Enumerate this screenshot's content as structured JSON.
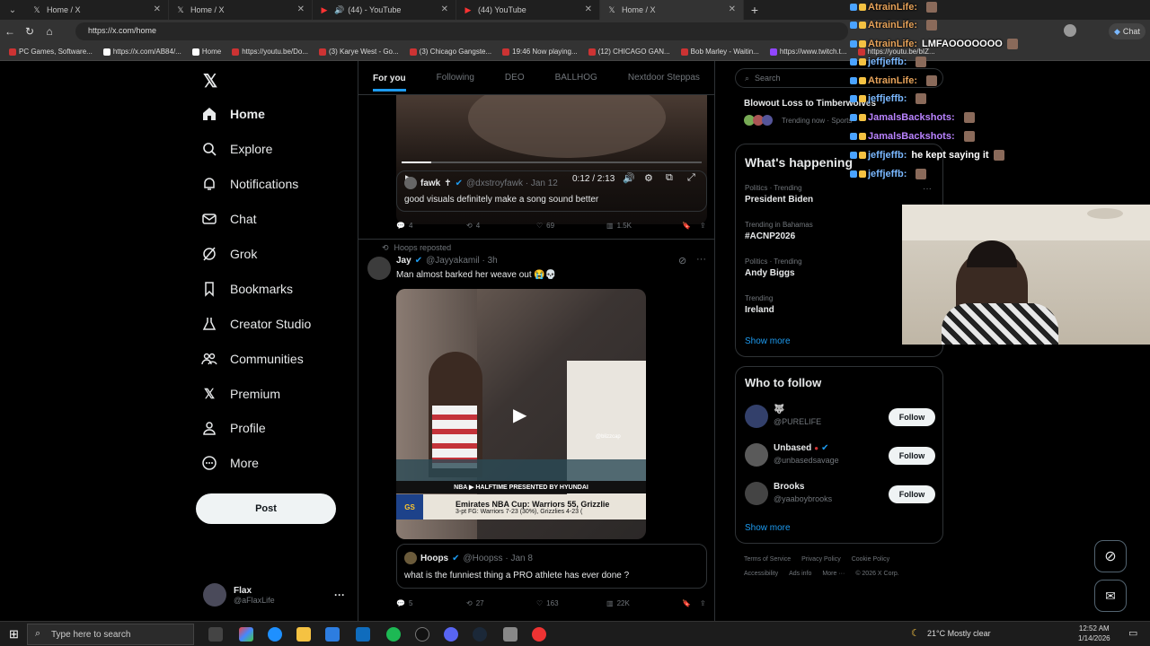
{
  "browser": {
    "tabs": [
      {
        "title": "Home / X",
        "icon": "x-logo-icon"
      },
      {
        "title": "Home / X",
        "icon": "x-logo-icon"
      },
      {
        "title": "(44) - YouTube",
        "icon": "youtube-icon"
      },
      {
        "title": "(44) YouTube",
        "icon": "youtube-icon"
      },
      {
        "title": "Home / X",
        "icon": "x-logo-icon"
      }
    ],
    "url": "https://x.com/home",
    "chat_label": "Chat",
    "bookmarks": [
      "PC Games, Software...",
      "https://x.com/AB84/...",
      "Home",
      "https://youtu.be/Do...",
      "(3) Karye West - Go...",
      "(3) Chicago Gangste...",
      "19:46 Now playing...",
      "(12) CHICAGO GAN...",
      "Bob Marley - Waitin...",
      "https://www.twitch.t...",
      "https://youtu.be/bIZ..."
    ]
  },
  "nav": {
    "items": [
      "Home",
      "Explore",
      "Notifications",
      "Chat",
      "Grok",
      "Bookmarks",
      "Creator Studio",
      "Communities",
      "Premium",
      "Profile",
      "More"
    ],
    "post_label": "Post",
    "profile_name": "Flax",
    "profile_handle": "@aFlaxLife",
    "more_dots": "···"
  },
  "timeline": {
    "tabs": [
      "For you",
      "Following",
      "DEO",
      "BALLHOG",
      "Nextdoor Steppas"
    ],
    "tweet1": {
      "video_time": "0:12 / 2:13",
      "quote_name": "fawk",
      "quote_name_suffix": "✝",
      "quote_handle_date": "@dxstroyfawk · Jan 12",
      "quote_text": "good visuals definitely make a song sound better",
      "replies": "4",
      "reposts": "4",
      "likes": "69",
      "views": "1.5K"
    },
    "tweet2": {
      "repost_label": "Hoops reposted",
      "name": "Jay",
      "handle_time": "@Jayyakamil · 3h",
      "text": "Man almost barked her weave out 😭💀",
      "video_watermark": "@blizzcap",
      "banner_top": "NBA ▶ HALFTIME PRESENTED BY HYUNDAI",
      "banner_team": "GS",
      "banner_main": "Emirates NBA Cup: Warriors 55, Grizzlie",
      "banner_sub": "3-pt FG: Warriors 7-23 (30%), Grizzlies 4-23 (",
      "quote_name": "Hoops",
      "quote_handle_date": "@Hoopss · Jan 8",
      "quote_text": "what is the funniest thing a PRO athlete has ever done ?",
      "replies": "5",
      "reposts": "27",
      "likes": "163",
      "views": "22K"
    }
  },
  "sidebar": {
    "search_placeholder": "Search",
    "top_trend_title": "Blowout Loss to Timberwolves",
    "top_trend_meta": "Trending now · Sports",
    "whats_happening": "What's happening",
    "trends": [
      {
        "meta": "Politics · Trending",
        "title": "President Biden"
      },
      {
        "meta": "Trending in Bahamas",
        "title": "#ACNP2026"
      },
      {
        "meta": "Politics · Trending",
        "title": "Andy Biggs"
      },
      {
        "meta": "Trending",
        "title": "Ireland"
      }
    ],
    "show_more": "Show more",
    "who_to_follow": "Who to follow",
    "follow_suggestions": [
      {
        "name": "",
        "handle": "@PURELIFE"
      },
      {
        "name": "Unbased",
        "handle": "@unbasedsavage"
      },
      {
        "name": "Brooks",
        "handle": "@yaaboybrooks"
      }
    ],
    "follow_label": "Follow",
    "footer_line1": [
      "Terms of Service",
      "Privacy Policy",
      "Cookie Policy"
    ],
    "footer_line2": [
      "Accessibility",
      "Ads info",
      "More ···",
      "© 2026 X Corp."
    ]
  },
  "chat_overlay": [
    {
      "user": "AtrainLife:",
      "msg": "",
      "color": "#e7a35a"
    },
    {
      "user": "AtrainLife:",
      "msg": "",
      "color": "#e7a35a"
    },
    {
      "user": "AtrainLife:",
      "msg": "LMFAOOOOOOO",
      "color": "#e7a35a"
    },
    {
      "user": "jeffjeffb:",
      "msg": "",
      "color": "#7ab8ff"
    },
    {
      "user": "AtrainLife:",
      "msg": "",
      "color": "#e7a35a"
    },
    {
      "user": "jeffjeffb:",
      "msg": "",
      "color": "#7ab8ff"
    },
    {
      "user": "JamalsBackshots:",
      "msg": "",
      "color": "#b983ff"
    },
    {
      "user": "JamalsBackshots:",
      "msg": "",
      "color": "#b983ff"
    },
    {
      "user": "jeffjeffb:",
      "msg": "he kept saying it",
      "color": "#7ab8ff"
    },
    {
      "user": "jeffjeffb:",
      "msg": "",
      "color": "#7ab8ff"
    }
  ],
  "taskbar": {
    "search_placeholder": "Type here to search",
    "weather": "21°C  Mostly clear",
    "time": "12:52 AM",
    "date": "1/14/2026"
  }
}
